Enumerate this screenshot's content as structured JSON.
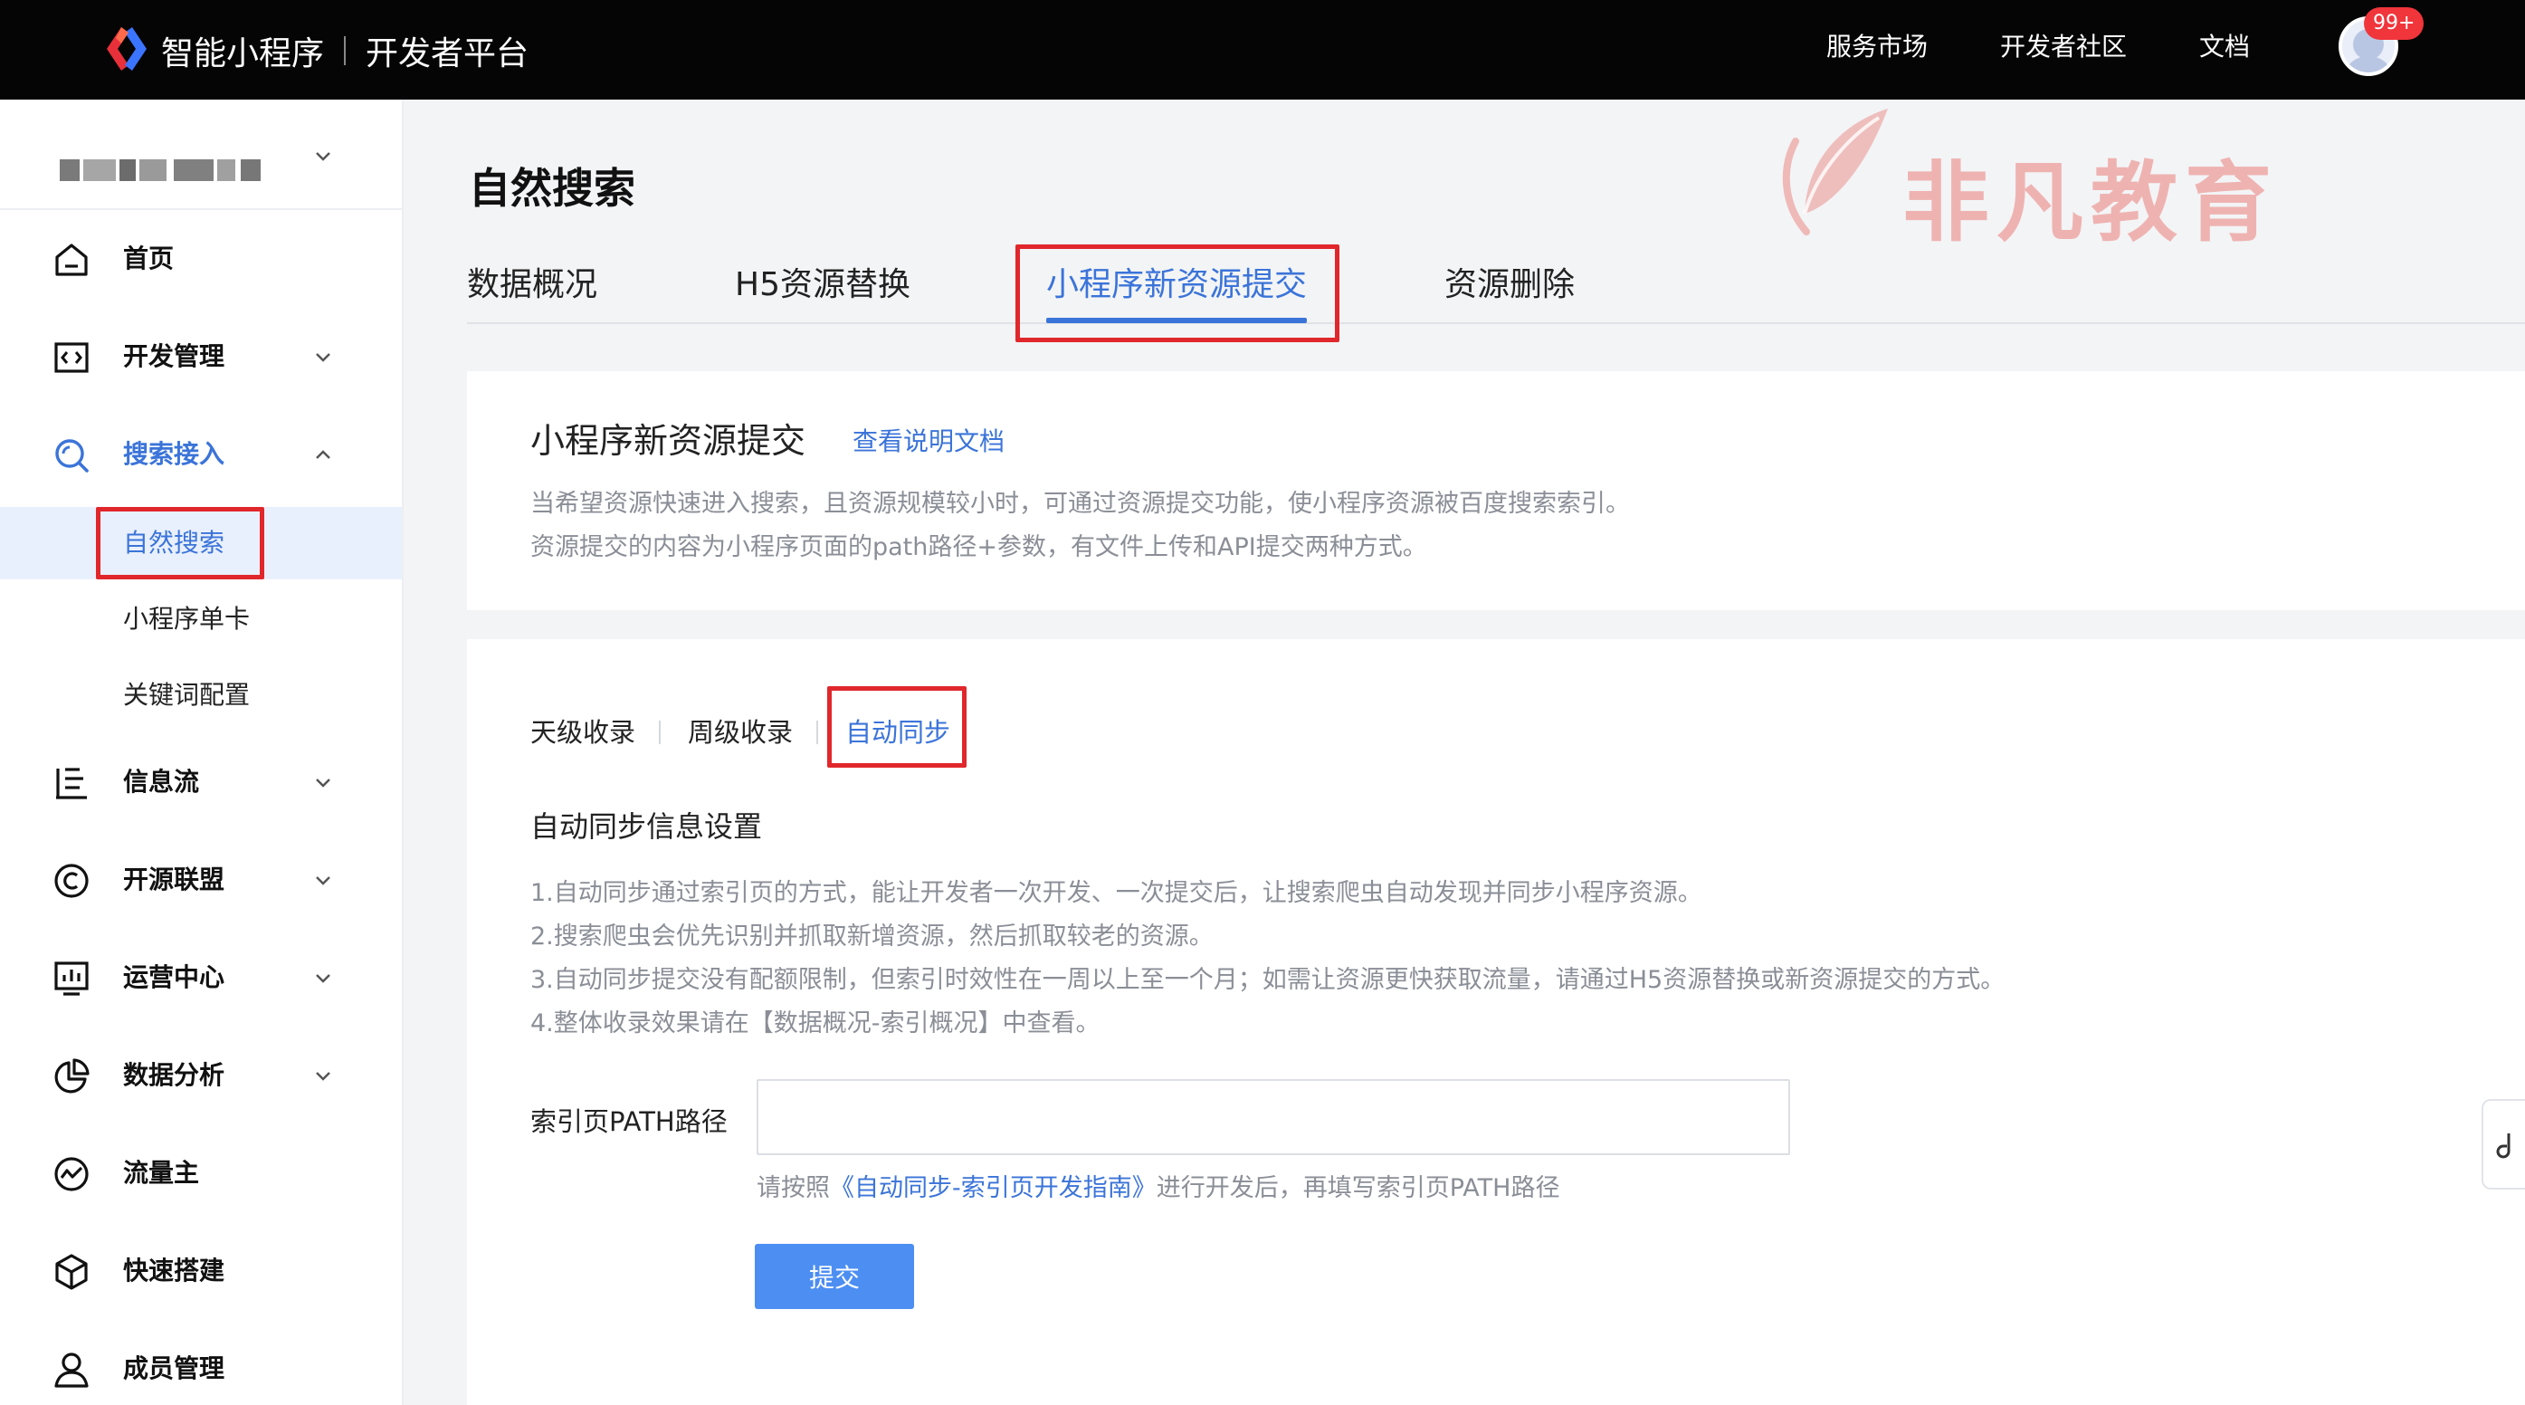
{
  "header": {
    "brand_name": "智能小程序",
    "platform_name": "开发者平台",
    "nav": [
      "服务市场",
      "开发者社区",
      "文档"
    ],
    "notification_count": "99+"
  },
  "sidebar": {
    "items": [
      {
        "label": "首页",
        "icon": "home-icon"
      },
      {
        "label": "开发管理",
        "icon": "code-icon"
      },
      {
        "label": "搜索接入",
        "icon": "search-icon"
      },
      {
        "label": "信息流",
        "icon": "list-icon"
      },
      {
        "label": "开源联盟",
        "icon": "copyright-icon"
      },
      {
        "label": "运营中心",
        "icon": "chart-icon"
      },
      {
        "label": "数据分析",
        "icon": "pie-icon"
      },
      {
        "label": "流量主",
        "icon": "trend-icon"
      },
      {
        "label": "快速搭建",
        "icon": "cube-icon"
      },
      {
        "label": "成员管理",
        "icon": "user-icon"
      }
    ],
    "search_sub_items": [
      "自然搜索",
      "小程序单卡",
      "关键词配置"
    ]
  },
  "page": {
    "title": "自然搜索",
    "tabs": [
      "数据概况",
      "H5资源替换",
      "小程序新资源提交",
      "资源删除"
    ],
    "active_tab": "小程序新资源提交"
  },
  "watermark": "非凡教育",
  "intro_card": {
    "title": "小程序新资源提交",
    "doc_link": "查看说明文档",
    "desc": [
      "当希望资源快速进入搜索，且资源规模较小时，可通过资源提交功能，使小程序资源被百度搜索索引。",
      "资源提交的内容为小程序页面的path路径+参数，有文件上传和API提交两种方式。"
    ]
  },
  "sync_card": {
    "sub_tabs": [
      "天级收录",
      "周级收录",
      "自动同步"
    ],
    "section_title": "自动同步信息设置",
    "rules": [
      "1.自动同步通过索引页的方式，能让开发者一次开发、一次提交后，让搜索爬虫自动发现并同步小程序资源。",
      "2.搜索爬虫会优先识别并抓取新增资源，然后抓取较老的资源。",
      "3.自动同步提交没有配额限制，但索引时效性在一周以上至一个月；如需让资源更快获取流量，请通过H5资源替换或新资源提交的方式。",
      "4.整体收录效果请在【数据概况-索引概况】中查看。"
    ],
    "field_label": "索引页PATH路径",
    "field_value": "",
    "hint_prefix": "请按照",
    "hint_link": "《自动同步-索引页开发指南》",
    "hint_suffix": "进行开发后，再填写索引页PATH路径",
    "submit_label": "提交"
  },
  "colors": {
    "accent": "#3b74d9",
    "highlight_box": "#e0272b",
    "topbar": "#050505",
    "button": "#4c8ef2"
  }
}
